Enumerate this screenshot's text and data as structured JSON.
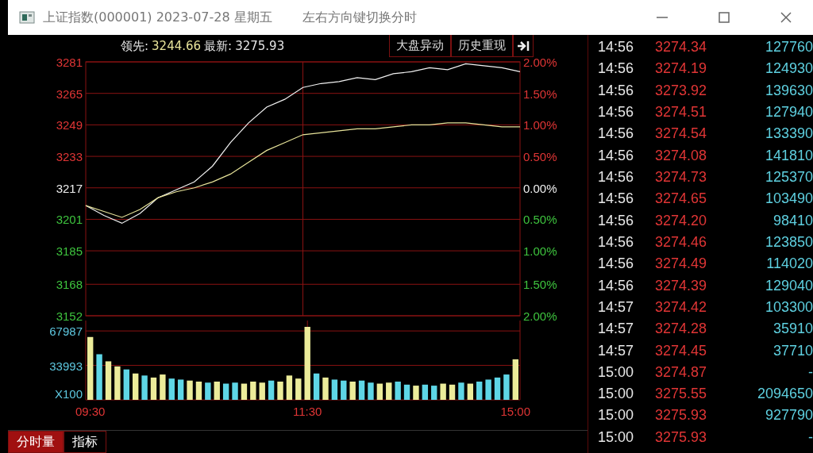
{
  "window": {
    "title": "上证指数(000001) 2023-07-28 星期五",
    "hint": "左右方向键切换分时"
  },
  "header": {
    "lead_label": "领先:",
    "lead_value": "3244.66",
    "latest_label": "最新:",
    "latest_value": "3275.93",
    "buttons": [
      "大盘异动",
      "历史重现"
    ]
  },
  "price_chart": {
    "percent_labels": [
      {
        "label": "2.00%",
        "color": "#e03535"
      },
      {
        "label": "1.50%",
        "color": "#e03535"
      },
      {
        "label": "1.00%",
        "color": "#e03535"
      },
      {
        "label": "0.50%",
        "color": "#e03535"
      },
      {
        "label": "0.00%",
        "color": "#eeeeee"
      },
      {
        "label": "0.50%",
        "color": "#3ec43e"
      },
      {
        "label": "1.00%",
        "color": "#3ec43e"
      },
      {
        "label": "1.50%",
        "color": "#3ec43e"
      },
      {
        "label": "2.00%",
        "color": "#3ec43e"
      }
    ],
    "chart_data": {
      "type": "line",
      "grid": true,
      "categories": [
        null,
        null,
        null,
        null,
        null,
        null,
        null,
        null,
        null,
        null,
        null,
        null,
        null,
        null,
        null,
        null,
        null,
        null,
        null,
        null,
        null,
        null,
        null,
        null,
        null
      ],
      "ylim": [
        3152,
        3281
      ],
      "yticks": [
        {
          "value": 3281,
          "label": "3281"
        },
        {
          "value": 3265,
          "label": "3265"
        },
        {
          "value": 3249,
          "label": "3249"
        },
        {
          "value": 3233,
          "label": "3233"
        },
        {
          "value": 3217,
          "label": "3217"
        },
        {
          "value": 3201,
          "label": "3201"
        },
        {
          "value": 3185,
          "label": "3185"
        },
        {
          "value": 3168,
          "label": "3168"
        },
        {
          "value": 3152,
          "label": "3152"
        }
      ],
      "series": [
        {
          "color": "#f2f2f2",
          "values": [
            3208,
            3203,
            3199,
            3204,
            3212,
            3216,
            3220,
            3228,
            3240,
            3250,
            3258,
            3262,
            3268,
            3270,
            3271,
            3273,
            3272,
            3275,
            3276,
            3278,
            3277,
            3280,
            3279,
            3278,
            3276
          ]
        },
        {
          "color": "#e8e49a",
          "values": [
            3208,
            3205,
            3202,
            3206,
            3212,
            3215,
            3217,
            3220,
            3224,
            3230,
            3236,
            3240,
            3244,
            3245,
            3246,
            3247,
            3247,
            3248,
            3249,
            3249,
            3250,
            3250,
            3249,
            3248,
            3248
          ]
        }
      ]
    }
  },
  "volume_chart": {
    "chart_data": {
      "type": "bar",
      "stacked": true,
      "categories": [
        "09:30",
        null,
        null,
        null,
        null,
        null,
        null,
        null,
        null,
        null,
        null,
        null,
        null,
        null,
        null,
        null,
        null,
        null,
        null,
        null,
        null,
        null,
        null,
        null,
        "11:30",
        null,
        null,
        null,
        null,
        null,
        null,
        null,
        null,
        null,
        null,
        null,
        null,
        null,
        null,
        null,
        null,
        null,
        null,
        null,
        null,
        null,
        null,
        "15:00"
      ],
      "grid": true,
      "ylim": [
        0,
        72000
      ],
      "yticks": [
        {
          "value": 0,
          "label": "X100"
        },
        {
          "value": 33993,
          "label": "33993"
        },
        {
          "value": 67987,
          "label": "67987"
        }
      ],
      "series": [
        {
          "color": "#ecec9a",
          "values": [
            62000,
            null,
            38000,
            33000,
            null,
            26000,
            null,
            22000,
            25000,
            null,
            null,
            19000,
            18000,
            null,
            18000,
            null,
            null,
            16000,
            18000,
            17000,
            null,
            18000,
            24000,
            21000,
            72000,
            null,
            22000,
            null,
            null,
            18000,
            null,
            null,
            16000,
            17000,
            null,
            null,
            14000,
            null,
            null,
            16000,
            15000,
            null,
            16000,
            null,
            null,
            null,
            null,
            40000
          ]
        },
        {
          "color": "#5ed6e6",
          "values": [
            null,
            45000,
            null,
            null,
            30000,
            null,
            24000,
            null,
            null,
            21000,
            20000,
            null,
            null,
            17000,
            null,
            16000,
            17000,
            null,
            null,
            null,
            19000,
            null,
            null,
            null,
            null,
            26000,
            null,
            20000,
            19000,
            null,
            19000,
            17000,
            null,
            null,
            18000,
            15000,
            null,
            15000,
            14000,
            null,
            null,
            17000,
            null,
            18000,
            20000,
            22000,
            25000,
            null
          ]
        }
      ]
    }
  },
  "tabs": [
    {
      "label": "分时量",
      "selected": true
    },
    {
      "label": "指标",
      "selected": false
    }
  ],
  "ticks": [
    {
      "time": "14:56",
      "price": "3274.34",
      "volume": "127760"
    },
    {
      "time": "14:56",
      "price": "3274.19",
      "volume": "124930"
    },
    {
      "time": "14:56",
      "price": "3273.92",
      "volume": "139630"
    },
    {
      "time": "14:56",
      "price": "3274.51",
      "volume": "127940"
    },
    {
      "time": "14:56",
      "price": "3274.54",
      "volume": "133390"
    },
    {
      "time": "14:56",
      "price": "3274.08",
      "volume": "141810"
    },
    {
      "time": "14:56",
      "price": "3274.73",
      "volume": "125370"
    },
    {
      "time": "14:56",
      "price": "3274.65",
      "volume": "103490"
    },
    {
      "time": "14:56",
      "price": "3274.20",
      "volume": "98410"
    },
    {
      "time": "14:56",
      "price": "3274.46",
      "volume": "123850"
    },
    {
      "time": "14:56",
      "price": "3274.49",
      "volume": "114020"
    },
    {
      "time": "14:56",
      "price": "3274.39",
      "volume": "129040"
    },
    {
      "time": "14:57",
      "price": "3274.42",
      "volume": "103300"
    },
    {
      "time": "14:57",
      "price": "3274.28",
      "volume": "35910"
    },
    {
      "time": "14:57",
      "price": "3274.45",
      "volume": "37710"
    },
    {
      "time": "15:00",
      "price": "3274.87",
      "volume": "-"
    },
    {
      "time": "15:00",
      "price": "3275.55",
      "volume": "2094650"
    },
    {
      "time": "15:00",
      "price": "3275.93",
      "volume": "927790"
    },
    {
      "time": "15:00",
      "price": "3275.93",
      "volume": "-"
    }
  ]
}
